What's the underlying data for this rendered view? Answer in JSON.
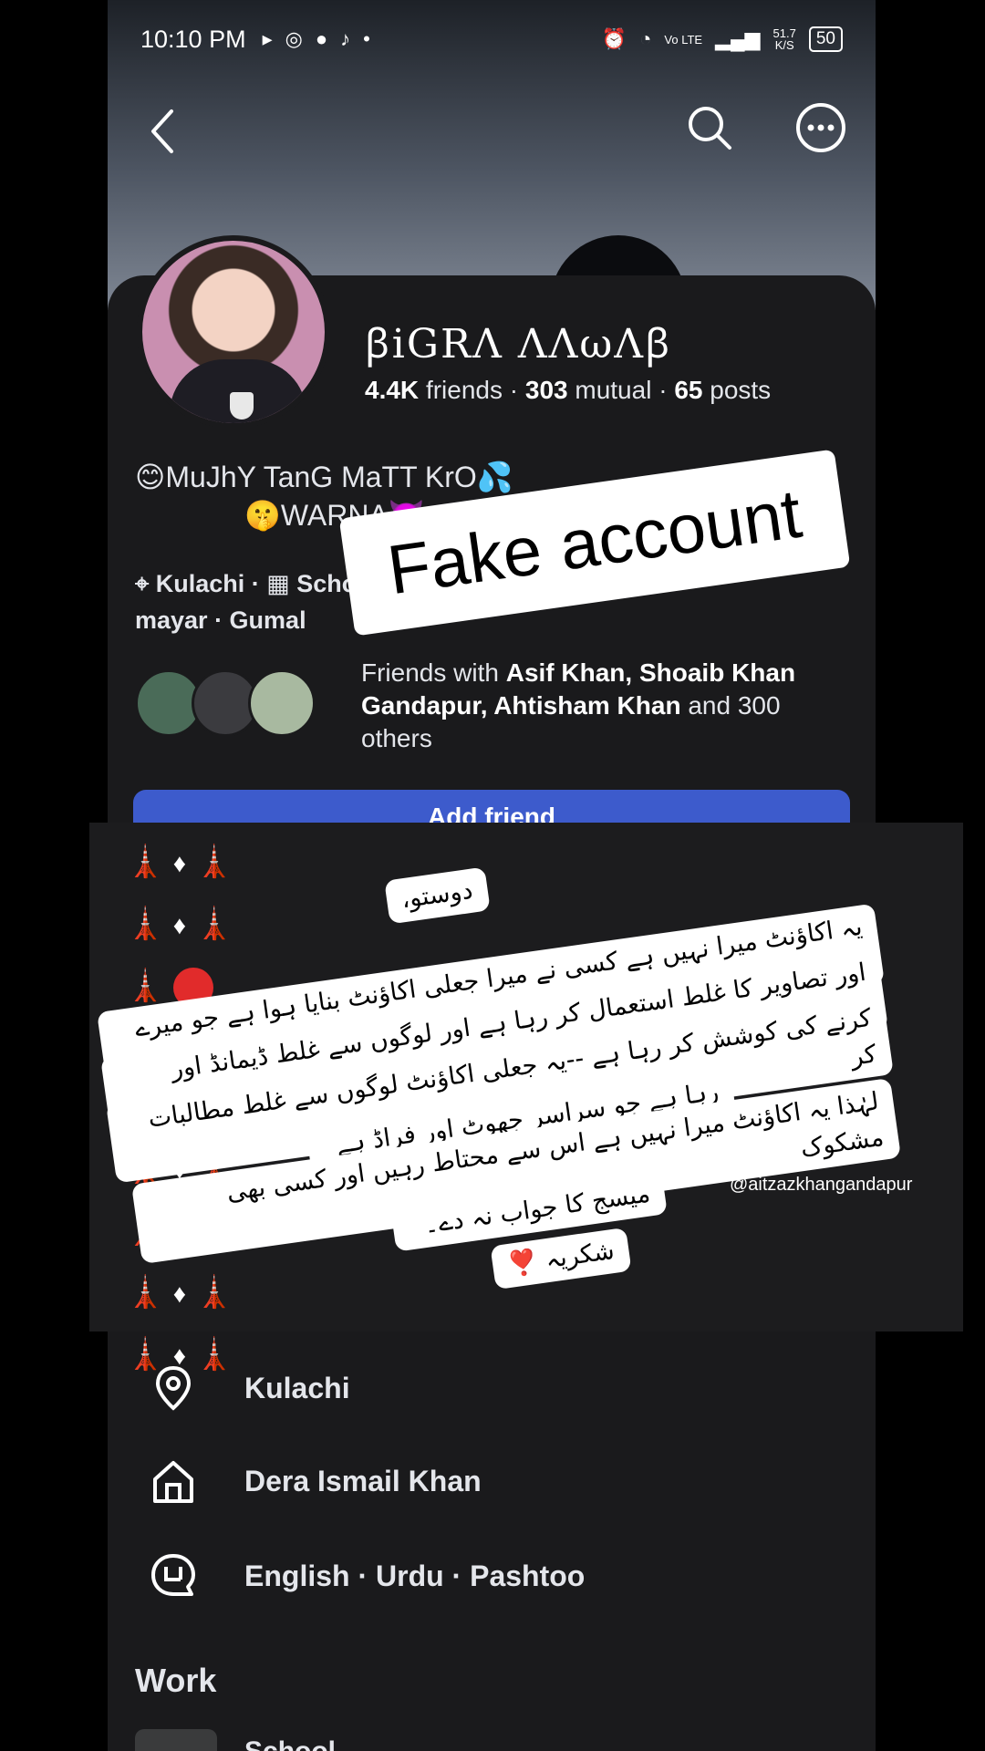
{
  "status_bar": {
    "time": "10:10 PM",
    "net_speed": "51.7",
    "net_unit": "K/S",
    "battery": "50",
    "network_label": "Vo LTE"
  },
  "nav": {
    "back_icon": "back-arrow-icon",
    "search_icon": "search-icon",
    "more_icon": "more-options-icon"
  },
  "profile": {
    "name": "ꞵiGRɅ ɅɅωɅꞵ",
    "friends_count": "4.4K",
    "friends_label": "friends",
    "mutual_count": "303",
    "mutual_label": "mutual",
    "posts_count": "65",
    "posts_label": "posts",
    "bio_line1": "😊MuJhY TanG MaTT KrO💦",
    "bio_line2": "🤫WARNA👿... See",
    "location": "Kulachi",
    "details_text": "mayar · Gumal",
    "school_suffix": "School",
    "friends_with_prefix": "Friends with",
    "friends_with_names": "Asif Khan, Shoaib Khan Gandapur, Ahtisham Khan",
    "friends_with_suffix": "and 300 others",
    "add_friend_label": "Add friend"
  },
  "sticker": {
    "text": "Fake account"
  },
  "overlay": {
    "greeting": "دوستو،",
    "line1": "یہ اکاؤنٹ میرا نہیں ہے کسی نے میرا جعلی اکاؤنٹ بنایا ہوا ہے جو میرے نام",
    "line2": "اور تصاویر کا غلط استعمال کر رہا ہے اور لوگوں سے غلط ڈیمانڈ اور بدنام",
    "line3": "کرنے کی کوشش کر رہا ہے --یہ جعلی اکاؤنٹ لوگوں سے غلط مطالبات کر",
    "line4": "رہا ہے جو سراسر جھوٹ اور فراڈ ہے",
    "line5": "لہٰذا یہ اکاؤنٹ میرا نہیں ہے اس سے محتاط رہیں اور کسی بھی مشکوک",
    "line6": "میسج کا جواب نہ دے۔",
    "thanks": "شکریہ ❣️",
    "watermark": "@aitzazkhangandapur"
  },
  "info_list": [
    {
      "icon": "location-pin-icon",
      "label": "Kulachi"
    },
    {
      "icon": "home-icon",
      "label": "Dera Ismail Khan"
    },
    {
      "icon": "language-icon",
      "label": "English · Urdu · Pashtoo"
    }
  ],
  "work": {
    "title": "Work",
    "item": "School"
  },
  "colors": {
    "background": "#18191a",
    "add_friend": "#3d5bcc",
    "sticker_bg": "#ffffff"
  }
}
